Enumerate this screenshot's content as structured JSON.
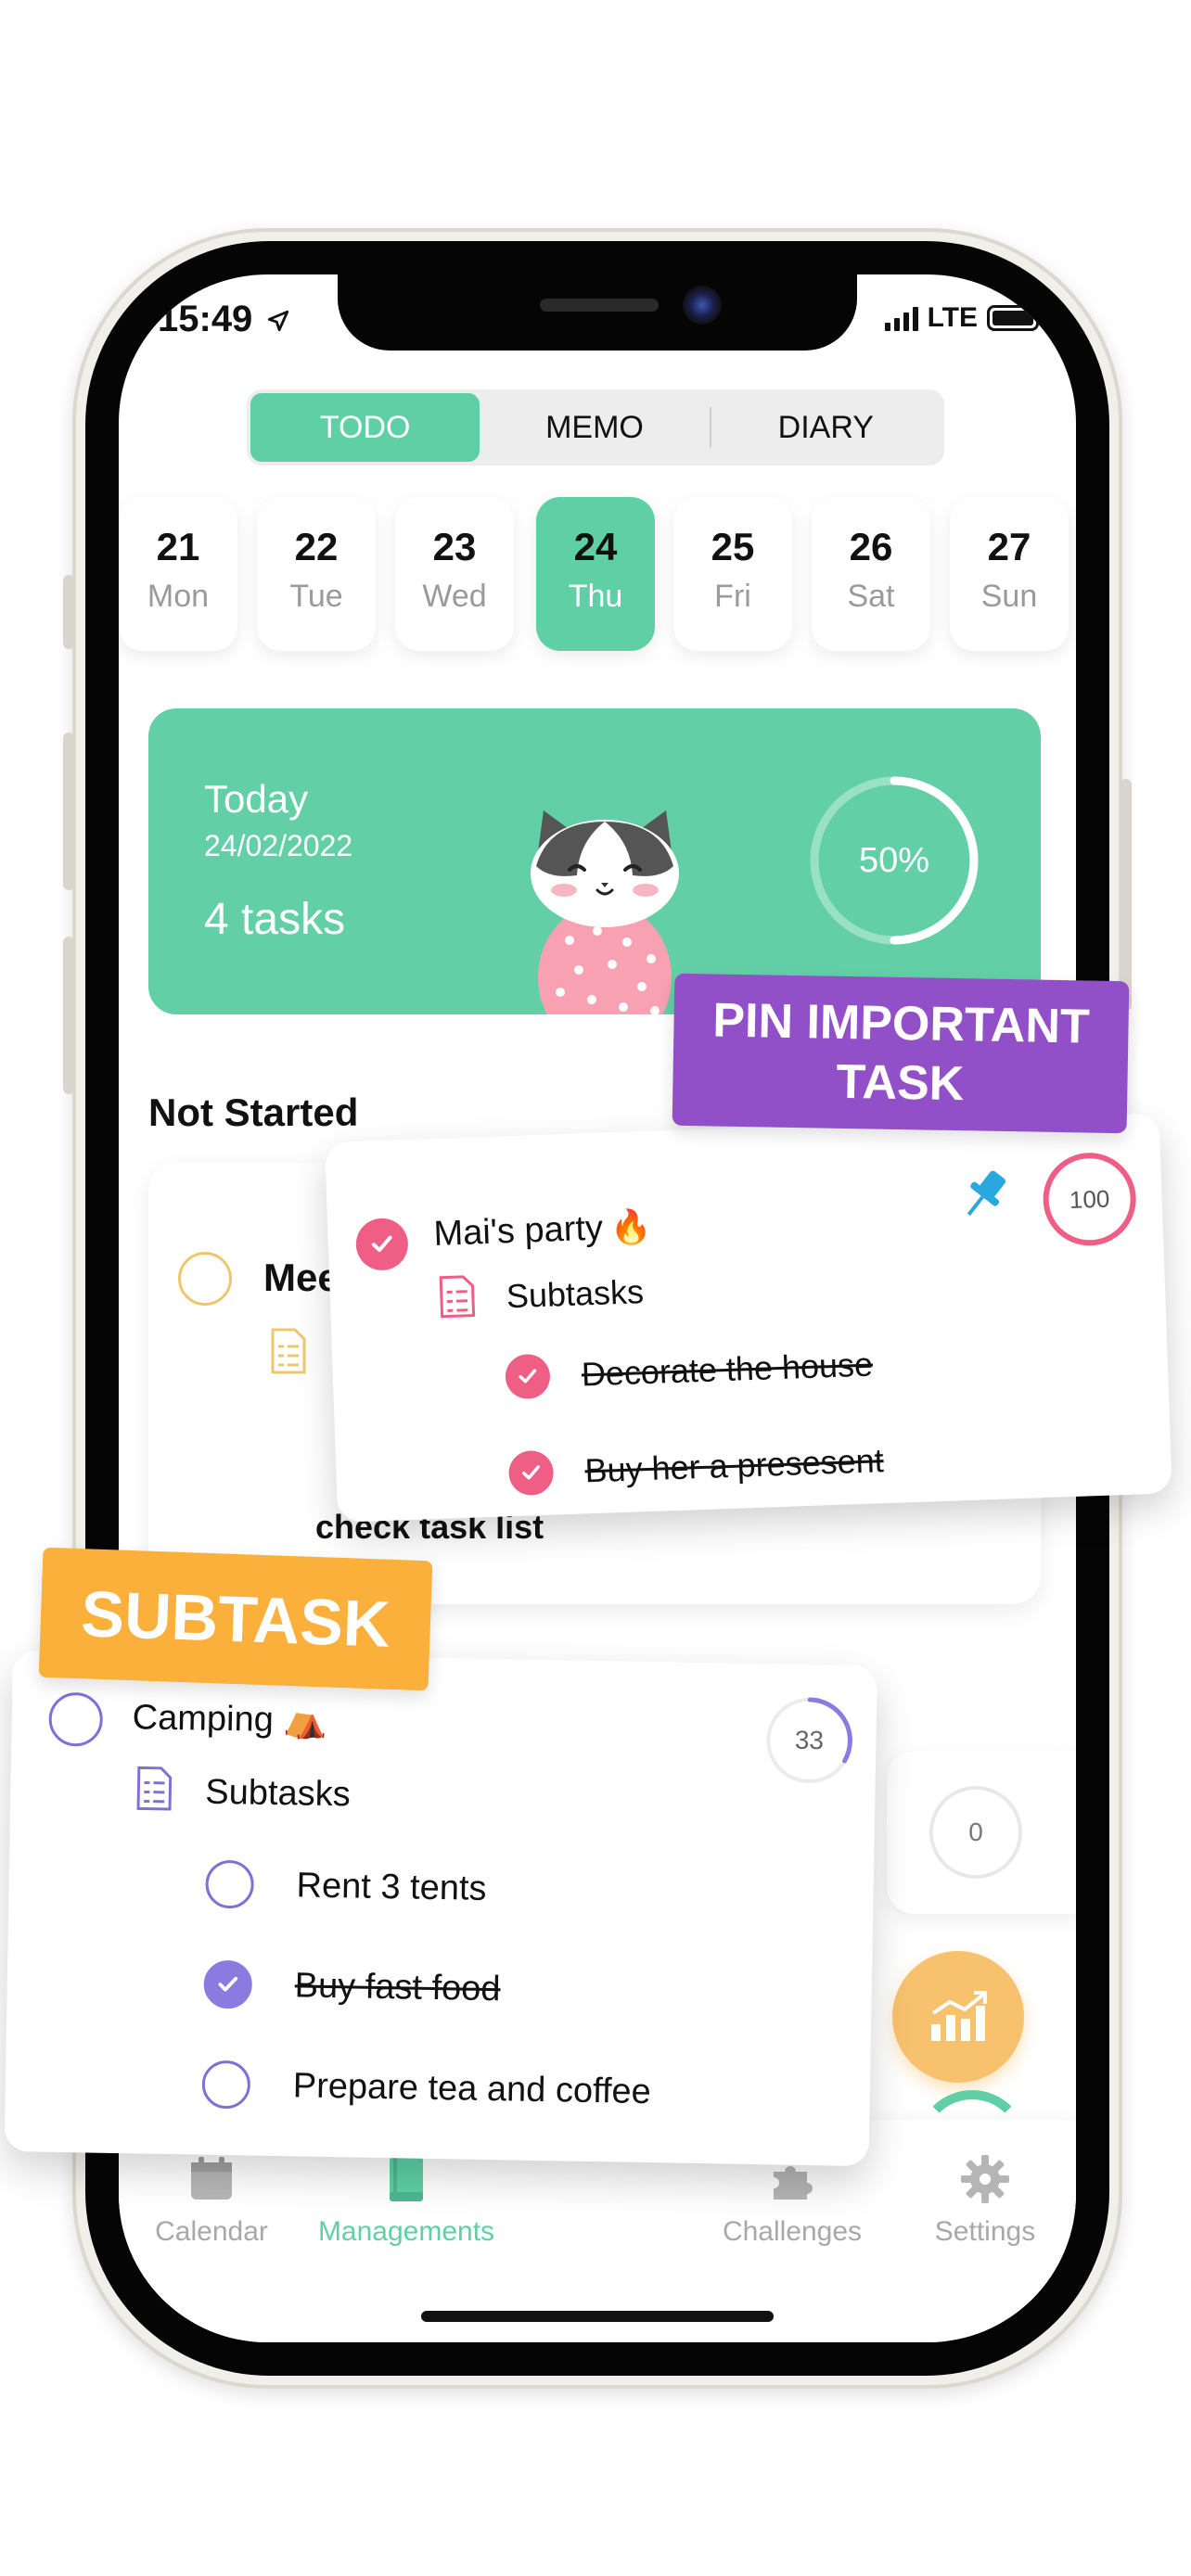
{
  "status": {
    "time": "15:49",
    "network": "LTE"
  },
  "segmented": {
    "todo": "TODO",
    "memo": "MEMO",
    "diary": "DIARY"
  },
  "days": [
    {
      "num": "21",
      "dow": "Mon"
    },
    {
      "num": "22",
      "dow": "Tue"
    },
    {
      "num": "23",
      "dow": "Wed"
    },
    {
      "num": "24",
      "dow": "Thu",
      "selected": true
    },
    {
      "num": "25",
      "dow": "Fri"
    },
    {
      "num": "26",
      "dow": "Sat"
    },
    {
      "num": "27",
      "dow": "Sun"
    }
  ],
  "today": {
    "title": "Today",
    "date": "24/02/2022",
    "tasks": "4 tasks",
    "progress_label": "50%",
    "progress": 0.5
  },
  "section": {
    "not_started": "Not Started"
  },
  "under_card": {
    "title_partial": "Mee",
    "bottom_partial": "check task list"
  },
  "right_card": {
    "score": "0"
  },
  "pin_banner": {
    "line1": "PIN IMPORTANT",
    "line2": "TASK"
  },
  "pinned_task": {
    "title": "Mai's party",
    "emoji": "🔥",
    "score": "100",
    "subtasks_label": "Subtasks",
    "subtasks": [
      {
        "label": "Decorate the house",
        "done": true
      },
      {
        "label": "Buy her a presesent",
        "done": true
      }
    ]
  },
  "subtask_banner": {
    "label": "SUBTASK"
  },
  "subtask_task": {
    "title": "Camping",
    "emoji": "⛺",
    "score": "33",
    "progress": 0.33,
    "subtasks_label": "Subtasks",
    "subtasks": [
      {
        "label": "Rent 3 tents",
        "done": false
      },
      {
        "label": "Buy fast food",
        "done": true
      },
      {
        "label": "Prepare tea and coffee",
        "done": false
      }
    ]
  },
  "tabbar": {
    "calendar": "Calendar",
    "managements": "Managements",
    "challenges": "Challenges",
    "settings": "Settings"
  },
  "colors": {
    "accent": "#5fd0a6",
    "pin": "#ee5e85",
    "purple": "#9150c8",
    "orange": "#fbb03b",
    "lavender": "#8b7be0"
  }
}
